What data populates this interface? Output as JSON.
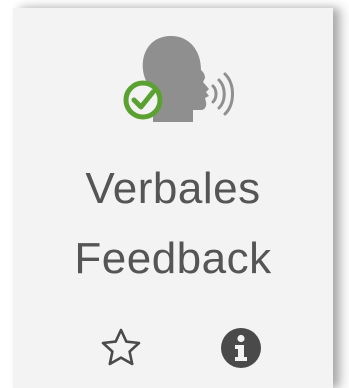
{
  "activity": {
    "icon": "speaking-head-with-check-icon",
    "title_line1": "Verbales",
    "title_line2": "Feedback"
  },
  "actions": [
    {
      "name": "favorite",
      "icon": "star-outline-icon"
    },
    {
      "name": "info",
      "icon": "info-circle-icon"
    }
  ],
  "colors": {
    "card_background": "#f3f3f3",
    "text": "#555555",
    "icon_gray": "#8f8f8f",
    "check_green": "#5aa132",
    "action_icon": "#4a4a4a"
  }
}
